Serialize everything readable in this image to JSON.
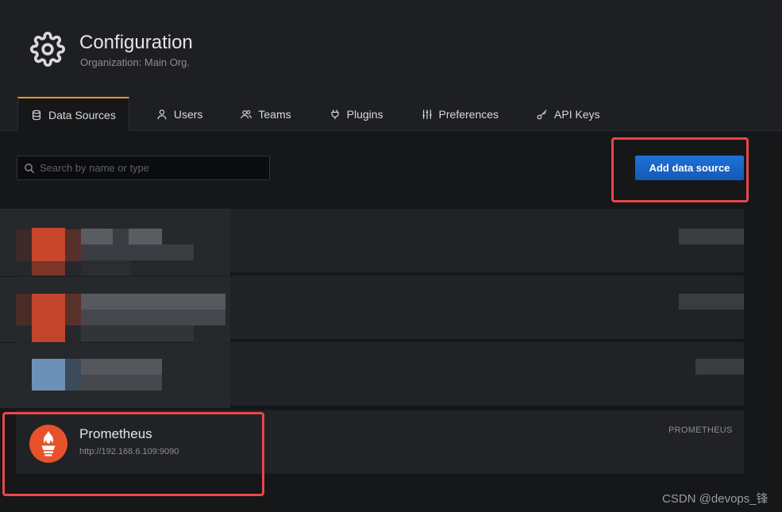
{
  "header": {
    "icon": "gear-icon",
    "title": "Configuration",
    "subtitle": "Organization: Main Org."
  },
  "tabs": [
    {
      "label": "Data Sources",
      "icon": "database-icon",
      "active": true
    },
    {
      "label": "Users",
      "icon": "user-icon",
      "active": false
    },
    {
      "label": "Teams",
      "icon": "users-icon",
      "active": false
    },
    {
      "label": "Plugins",
      "icon": "plug-icon",
      "active": false
    },
    {
      "label": "Preferences",
      "icon": "sliders-icon",
      "active": false
    },
    {
      "label": "API Keys",
      "icon": "key-icon",
      "active": false
    }
  ],
  "search": {
    "placeholder": "Search by name or type",
    "value": ""
  },
  "add_button": {
    "label": "Add data source"
  },
  "datasources": [
    {
      "name": "Prometheus",
      "url": "http://192.168.6.109:9090",
      "type": "PROMETHEUS",
      "icon": "prometheus-icon"
    }
  ],
  "watermark": "CSDN @devops_锋",
  "colors": {
    "accent": "#f79520",
    "primary_button": "#1e72d6",
    "highlight_box": "#e8474a",
    "prometheus": "#e6522c"
  }
}
